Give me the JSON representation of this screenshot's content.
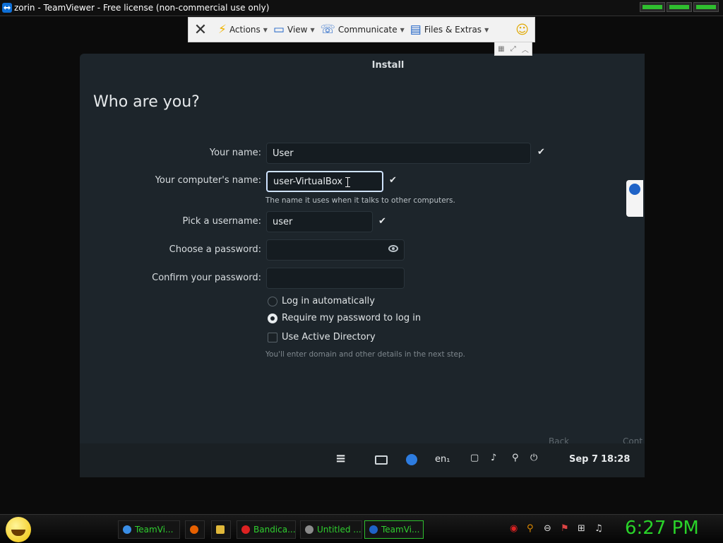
{
  "window": {
    "title": "zorin - TeamViewer - Free license (non-commercial use only)"
  },
  "toolbar": {
    "actions": "Actions",
    "view": "View",
    "communicate": "Communicate",
    "files": "Files & Extras"
  },
  "installer": {
    "header": "Install",
    "page_title": "Who are you?",
    "your_name_label": "Your name:",
    "your_name_value": "User",
    "computer_name_label": "Your computer's name:",
    "computer_name_value": "user-VirtualBox",
    "computer_name_hint": "The name it uses when it talks to other computers.",
    "username_label": "Pick a username:",
    "username_value": "user",
    "password_label": "Choose a password:",
    "confirm_label": "Confirm your password:",
    "login_auto": "Log in automatically",
    "require_password": "Require my password to log in",
    "active_directory": "Use Active Directory",
    "ad_hint": "You'll enter domain and other details in the next step.",
    "back": "Back",
    "continue": "Cont"
  },
  "panel": {
    "keyboard": "en₁",
    "date": "Sep 7",
    "time": "18:28"
  },
  "taskbar": {
    "tasks": [
      "TeamVi...",
      "Bandica...",
      "Untitled ...",
      "TeamVi..."
    ],
    "clock": "6:27 PM"
  }
}
